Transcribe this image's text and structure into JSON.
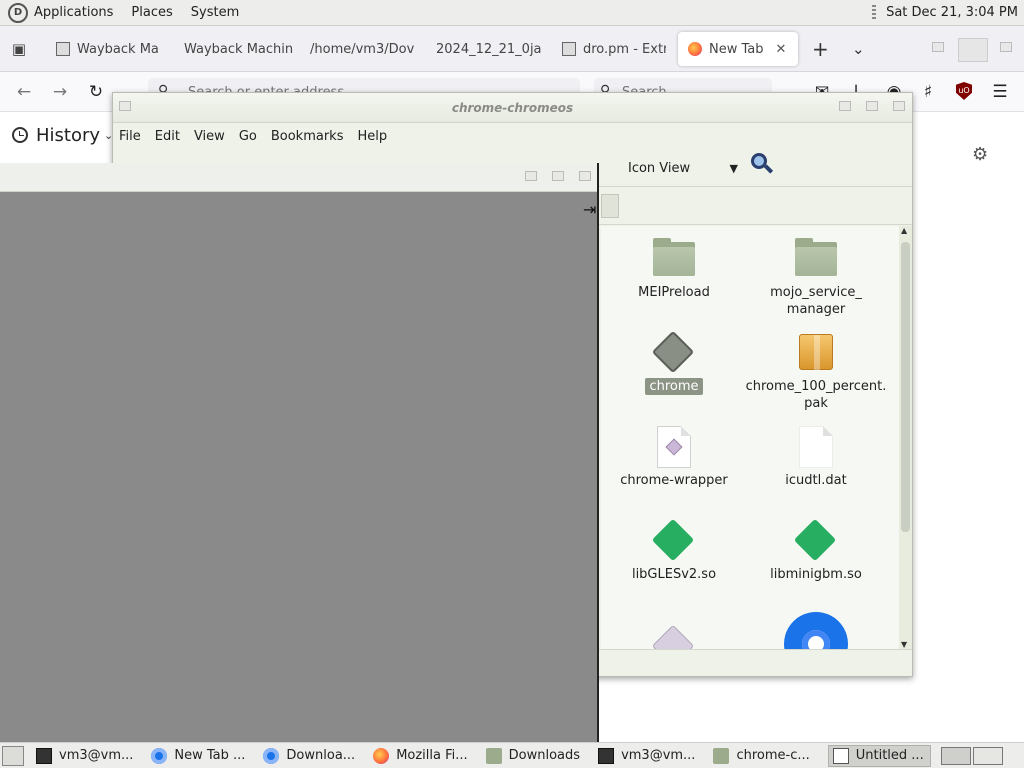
{
  "top_panel": {
    "menus": [
      "Applications",
      "Places",
      "System"
    ],
    "clock": "Sat Dec 21,  3:04 PM"
  },
  "browser": {
    "tabs": [
      {
        "label": "Wayback Ma",
        "icon": "archive-icon"
      },
      {
        "label": "Wayback Machin",
        "icon": "none"
      },
      {
        "label": "/home/vm3/Dov",
        "icon": "none"
      },
      {
        "label": "2024_12_21_0ja",
        "icon": "none"
      },
      {
        "label": "dro.pm - Extr",
        "icon": "page-icon"
      },
      {
        "label": "New Tab",
        "icon": "firefox-icon",
        "active": true
      }
    ],
    "url_placeholder": "Search or enter address",
    "search_placeholder": "Search",
    "sidebar_title": "History"
  },
  "file_manager": {
    "title": "chrome-chromeos",
    "menus": [
      "File",
      "Edit",
      "View",
      "Go",
      "Bookmarks",
      "Help"
    ],
    "view_mode": "Icon View",
    "files": [
      {
        "name": "MEIPreload",
        "type": "folder"
      },
      {
        "name": "mojo_service_\nmanager",
        "type": "folder"
      },
      {
        "name": "chrome",
        "type": "executable",
        "selected": true
      },
      {
        "name": "chrome_100_percent.\npak",
        "type": "package"
      },
      {
        "name": "chrome-wrapper",
        "type": "script"
      },
      {
        "name": "icudtl.dat",
        "type": "data"
      },
      {
        "name": "libGLESv2.so",
        "type": "library"
      },
      {
        "name": "libminigbm.so",
        "type": "library"
      }
    ]
  },
  "taskbar": {
    "items": [
      {
        "label": "vm3@vm...",
        "icon": "terminal-icon"
      },
      {
        "label": "New Tab ...",
        "icon": "chrome-icon"
      },
      {
        "label": "Downloa...",
        "icon": "chrome-icon"
      },
      {
        "label": "Mozilla Fi...",
        "icon": "firefox-icon"
      },
      {
        "label": "Downloads",
        "icon": "folder-icon"
      },
      {
        "label": "vm3@vm...",
        "icon": "terminal-icon"
      },
      {
        "label": "chrome-c...",
        "icon": "folder-icon"
      },
      {
        "label": "Untitled ...",
        "icon": "text-editor-icon",
        "active": true
      }
    ]
  }
}
